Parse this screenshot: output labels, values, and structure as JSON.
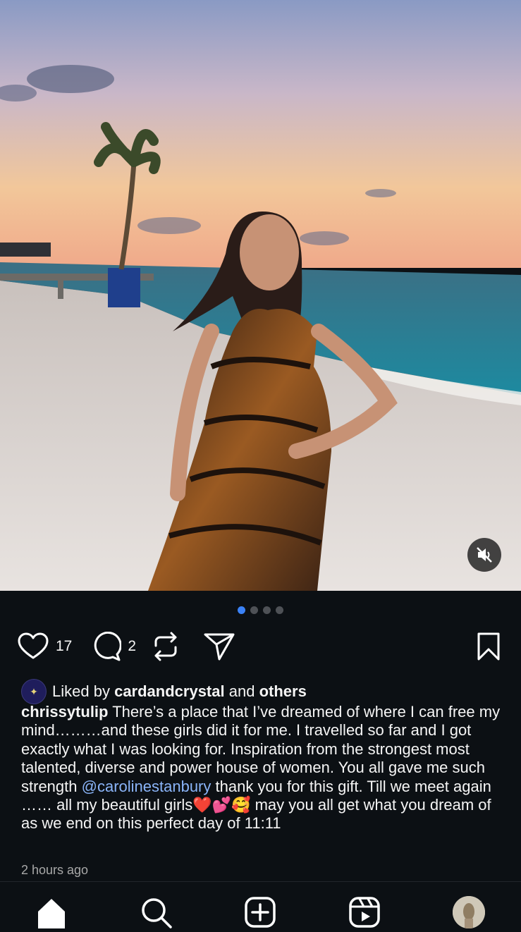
{
  "post": {
    "carousel": {
      "total": 4,
      "active": 0
    },
    "likes_count": "17",
    "comments_count": "2",
    "liked_by": {
      "prefix": "Liked by",
      "user": "cardandcrystal",
      "connector": "and",
      "others": "others"
    },
    "caption": {
      "username": "chrissytulip",
      "text_before_mention": "There’s a place that I’ve dreamed of where I can free my mind………and these girls did it for me. I travelled so far and I got exactly what I was looking for. Inspiration from the strongest most talented, diverse and power house of women. You all gave me such strength",
      "mention": "@carolinestanbury",
      "text_after_mention": "thank you for this gift.  Till we meet again …… all my beautiful girls❤️💕🥰 may you all get what you dream of as we end on this perfect day of 11:11"
    },
    "timestamp": "2 hours ago"
  },
  "icons": {
    "like": "heart-icon",
    "comment": "comment-icon",
    "repost": "repost-icon",
    "share": "share-icon",
    "save": "bookmark-icon",
    "mute": "speaker-muted-icon"
  },
  "colors": {
    "background": "#0c1014",
    "active_dot": "#3b82f6",
    "mention": "#8ab4f8"
  }
}
